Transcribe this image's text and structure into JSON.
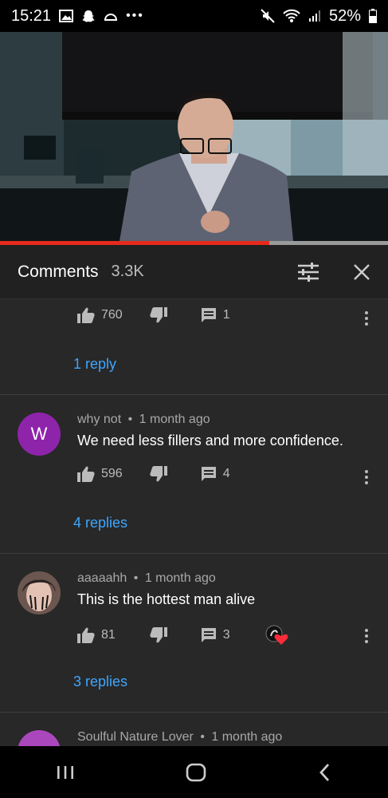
{
  "status": {
    "time": "15:21",
    "battery": "52%"
  },
  "video": {
    "progress_fraction": 0.695
  },
  "header": {
    "title": "Comments",
    "count": "3.3K"
  },
  "comments": [
    {
      "likes": "760",
      "reply_count": "1",
      "replies_label": "1 reply"
    },
    {
      "author": "why not",
      "sep": "•",
      "age": "1 month ago",
      "avatar_letter": "W",
      "avatar_color": "#8e24aa",
      "text": "We need less fillers and more confidence.",
      "likes": "596",
      "reply_count": "4",
      "replies_label": "4 replies"
    },
    {
      "author": "aaaaahh",
      "sep": "•",
      "age": "1 month ago",
      "text": "This is the hottest man alive",
      "likes": "81",
      "reply_count": "3",
      "replies_label": "3 replies"
    },
    {
      "author": "Soulful Nature Lover",
      "sep": "•",
      "age": "1 month ago",
      "avatar_color": "#ab47bc"
    }
  ],
  "colors": {
    "accent_red": "#e52a1d",
    "link_blue": "#3ea6ff",
    "background": "#282828"
  }
}
